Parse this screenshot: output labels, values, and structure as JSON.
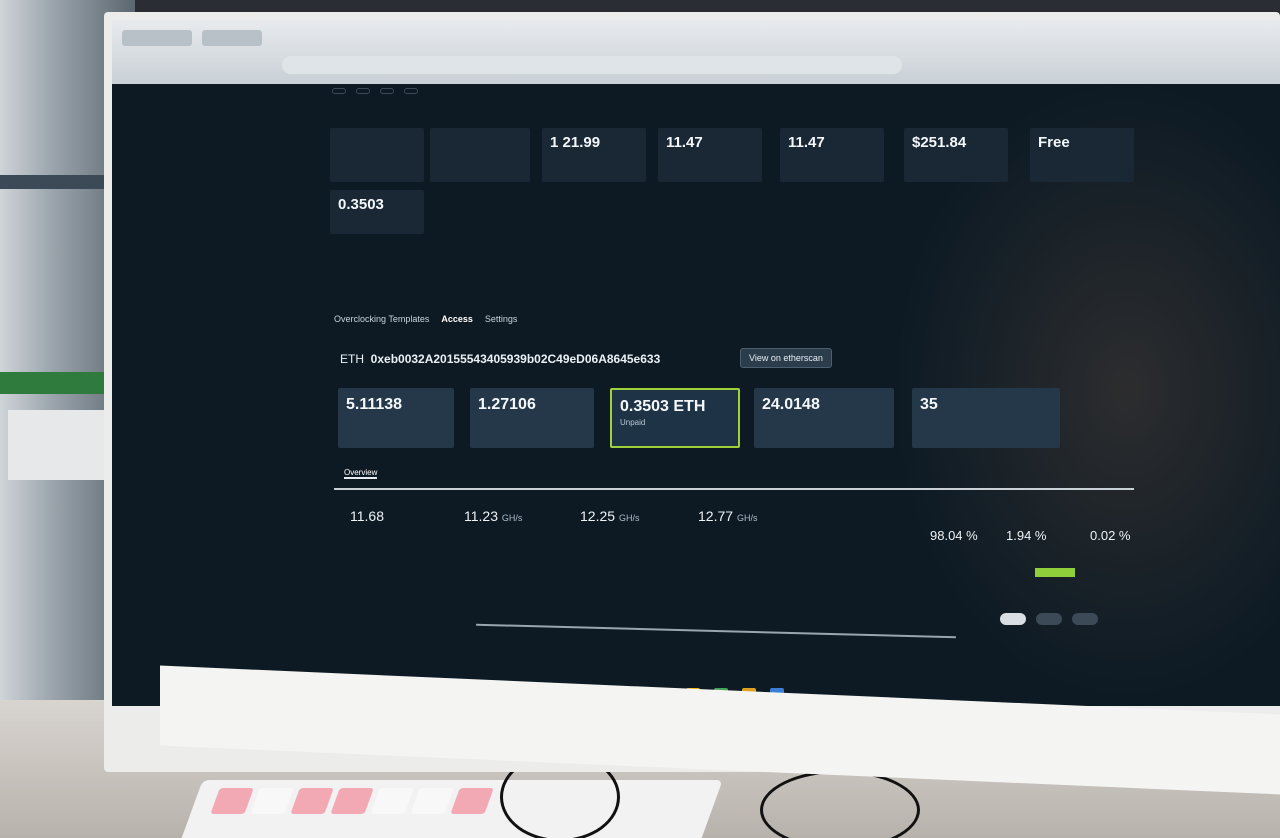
{
  "header": {
    "top_links": [
      "",
      "",
      "",
      ""
    ],
    "top_right": [
      "",
      "",
      ""
    ]
  },
  "tiles": [
    {
      "val": "",
      "sub": ""
    },
    {
      "val": "",
      "sub": ""
    },
    {
      "val": "1 21.99",
      "sub": ""
    },
    {
      "val": "11.47",
      "sub": ""
    },
    {
      "val": "11.47",
      "sub": ""
    },
    {
      "val": "$251.84",
      "sub": ""
    },
    {
      "val": "Free",
      "sub": ""
    },
    {
      "val": "0.3503",
      "sub": ""
    }
  ],
  "nav": [
    "Overclocking Templates",
    "Access",
    "Settings"
  ],
  "wallet": {
    "prefix": "ETH",
    "address": "0xeb0032A20155543405939b02C49eD06A8645e633",
    "button": "View on etherscan"
  },
  "cards": [
    {
      "hdr": "",
      "big": "5.11138",
      "foot": ""
    },
    {
      "hdr": "",
      "big": "1.27106",
      "foot": ""
    },
    {
      "hdr": "",
      "big": "0.3503 ETH",
      "foot": "Unpaid"
    },
    {
      "hdr": "",
      "big": "24.0148",
      "foot": ""
    },
    {
      "hdr": "",
      "big": "35",
      "foot": ""
    }
  ],
  "subtabs": [
    "Overview",
    "",
    ""
  ],
  "stats": [
    {
      "value": "11.68",
      "unit": "",
      "label": ""
    },
    {
      "value": "11.23",
      "unit": "GH/s",
      "label": ""
    },
    {
      "value": "12.25",
      "unit": "GH/s",
      "label": ""
    },
    {
      "value": "12.77",
      "unit": "GH/s",
      "label": ""
    }
  ],
  "shares": [
    {
      "value": "98.04 %",
      "label": ""
    },
    {
      "value": "1.94 %",
      "label": ""
    },
    {
      "value": "0.02 %",
      "label": ""
    }
  ],
  "chart_legend": [
    "",
    "",
    ""
  ]
}
